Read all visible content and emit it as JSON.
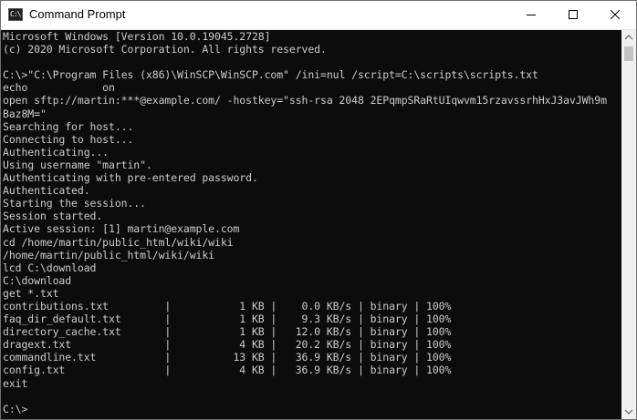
{
  "window": {
    "title": "Command Prompt",
    "icon_label": "C:\\"
  },
  "console": {
    "lines": [
      "Microsoft Windows [Version 10.0.19045.2728]",
      "(c) 2020 Microsoft Corporation. All rights reserved.",
      "",
      "C:\\>\"C:\\Program Files (x86)\\WinSCP\\WinSCP.com\" /ini=nul /script=C:\\scripts\\scripts.txt",
      "echo            on",
      "open sftp://martin:***@example.com/ -hostkey=\"ssh-rsa 2048 2EPqmpSRaRtUIqwvm15rzavssrhHxJ3avJWh9m",
      "Baz8M=\"",
      "Searching for host...",
      "Connecting to host...",
      "Authenticating...",
      "Using username \"martin\".",
      "Authenticating with pre-entered password.",
      "Authenticated.",
      "Starting the session...",
      "Session started.",
      "Active session: [1] martin@example.com",
      "cd /home/martin/public_html/wiki/wiki",
      "/home/martin/public_html/wiki/wiki",
      "lcd C:\\download",
      "C:\\download",
      "get *.txt",
      "contributions.txt         |           1 KB |    0.0 KB/s | binary | 100%",
      "faq_dir_default.txt       |           1 KB |    9.3 KB/s | binary | 100%",
      "directory_cache.txt       |           1 KB |   12.0 KB/s | binary | 100%",
      "dragext.txt               |           4 KB |   20.2 KB/s | binary | 100%",
      "commandline.txt           |          13 KB |   36.9 KB/s | binary | 100%",
      "config.txt                |           4 KB |   36.9 KB/s | binary | 100%",
      "exit",
      "",
      "C:\\>"
    ]
  },
  "controls": {
    "minimize_icon": "minimize-icon",
    "maximize_icon": "maximize-icon",
    "close_icon": "close-icon"
  }
}
